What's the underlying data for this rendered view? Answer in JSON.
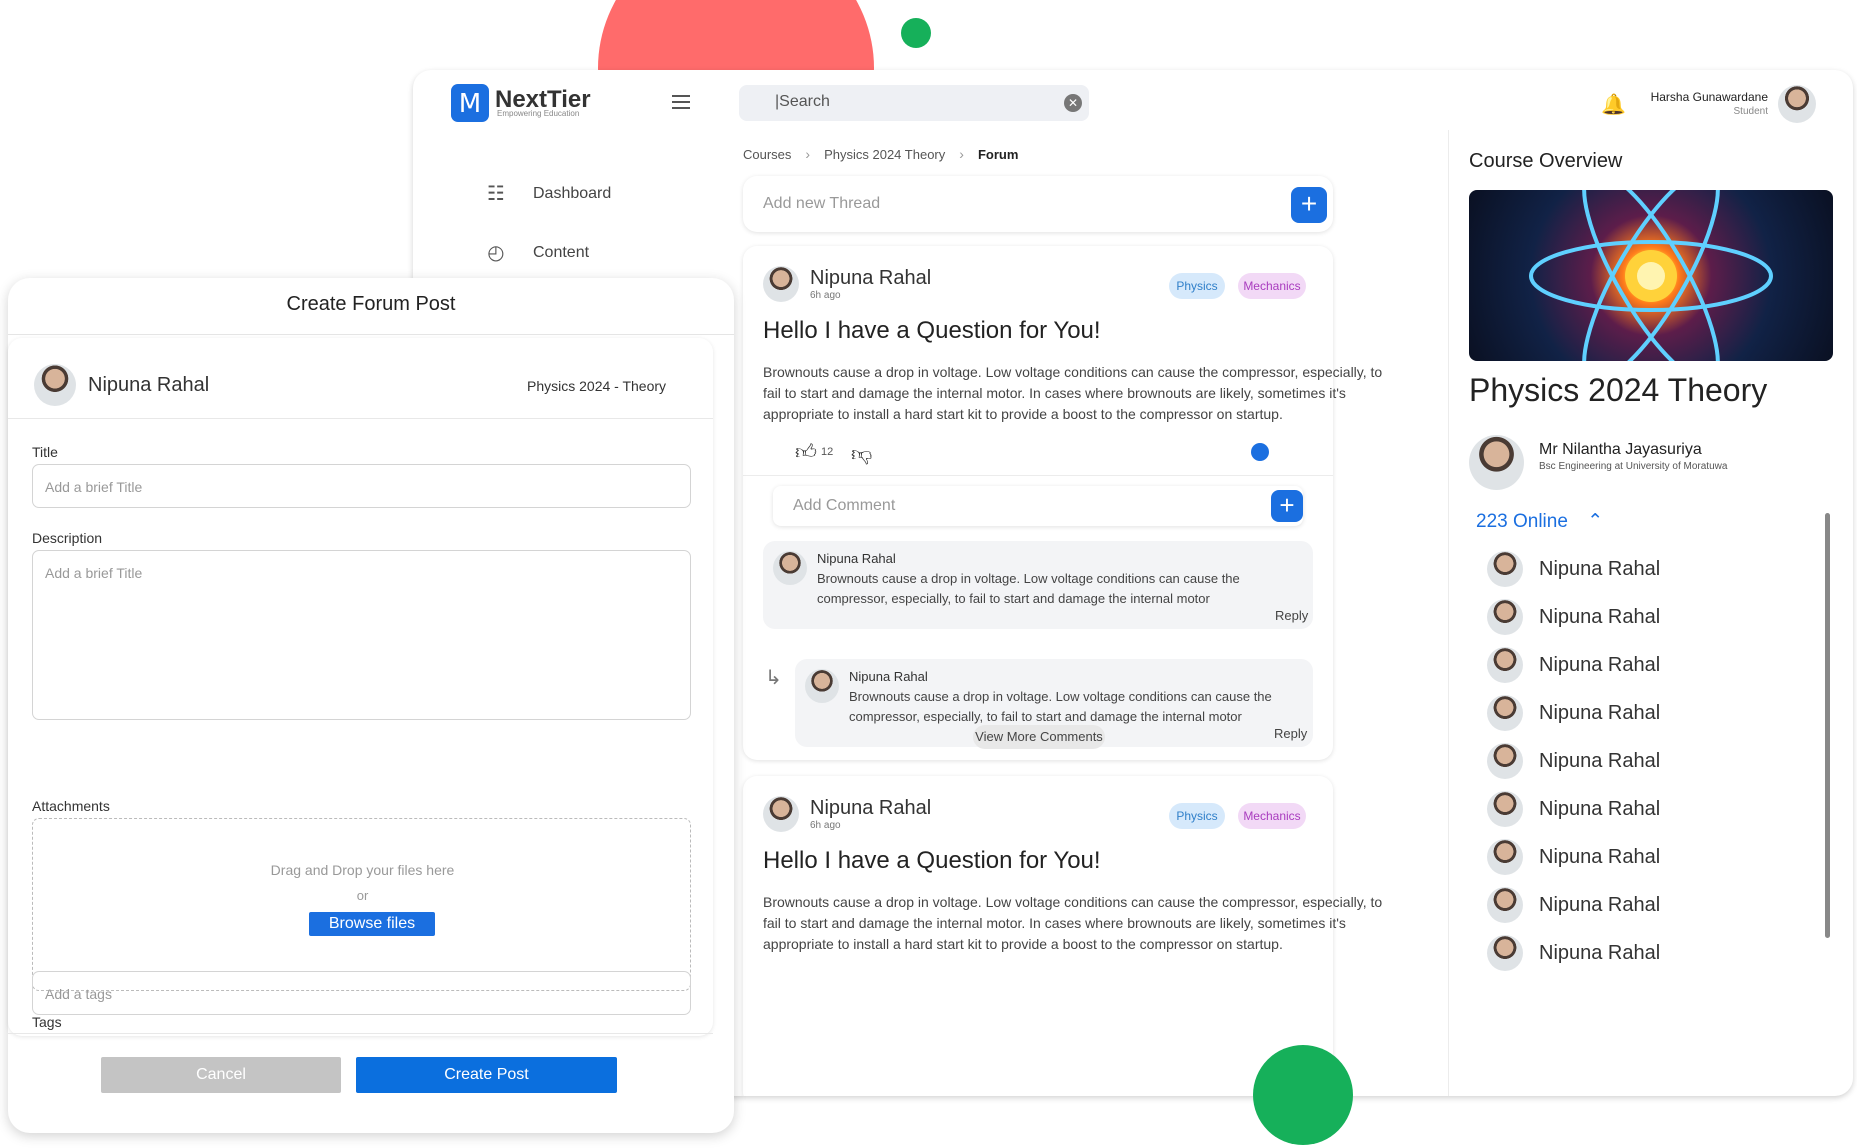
{
  "brand": {
    "name": "NextTier",
    "tagline": "Empowering Education"
  },
  "sidebar": {
    "items": [
      {
        "label": "Dashboard",
        "icon": "dashboard-icon"
      },
      {
        "label": "Content",
        "icon": "content-icon"
      }
    ]
  },
  "search": {
    "value": "|Search"
  },
  "user": {
    "name": "Harsha Gunawardane",
    "role": "Student"
  },
  "breadcrumb": [
    "Courses",
    "Physics 2024 Theory",
    "Forum"
  ],
  "thread_input": {
    "placeholder": "Add new Thread"
  },
  "posts": [
    {
      "author": "Nipuna Rahal",
      "time": "6h ago",
      "tags": [
        "Physics",
        "Mechanics"
      ],
      "title": "Hello I have a Question for You!",
      "body": "Brownouts cause a drop in voltage. Low voltage conditions can cause the compressor, especially, to fail to start and damage the internal motor. In cases where brownouts are likely, sometimes it's appropriate to install a hard start kit to provide a boost to the compressor on startup.",
      "likes": "12",
      "comment_placeholder": "Add Comment",
      "comments": [
        {
          "author": "Nipuna Rahal",
          "text": "Brownouts cause a drop in voltage. Low voltage conditions can cause the compressor, especially, to fail to start and damage the internal motor",
          "reply": "Reply"
        },
        {
          "author": "Nipuna Rahal",
          "text": "Brownouts cause a drop in voltage. Low voltage conditions can cause the compressor, especially, to fail to start and damage the internal motor",
          "reply": "Reply"
        }
      ],
      "view_more": "View More Comments"
    },
    {
      "author": "Nipuna Rahal",
      "time": "6h ago",
      "tags": [
        "Physics",
        "Mechanics"
      ],
      "title": "Hello I have a Question for You!",
      "body": "Brownouts cause a drop in voltage. Low voltage conditions can cause the compressor, especially, to fail to start and damage the internal motor. In cases where brownouts are likely, sometimes it's appropriate to install a hard start kit to provide a boost to the compressor on startup."
    }
  ],
  "course": {
    "heading": "Course Overview",
    "title": "Physics 2024 Theory",
    "lecturer": "Mr Nilantha Jayasuriya",
    "lecturer_detail": "Bsc Engineering at University of Moratuwa",
    "online_label": "223 Online",
    "online_users": [
      "Nipuna Rahal",
      "Nipuna Rahal",
      "Nipuna Rahal",
      "Nipuna Rahal",
      "Nipuna Rahal",
      "Nipuna Rahal",
      "Nipuna Rahal",
      "Nipuna Rahal",
      "Nipuna Rahal"
    ]
  },
  "modal": {
    "title": "Create Forum Post",
    "author": "Nipuna Rahal",
    "course": "Physics 2024 - Theory",
    "title_label": "Title",
    "title_placeholder": "Add a brief Title",
    "description_label": "Description",
    "description_placeholder": "Add a brief Title",
    "attachments_label": "Attachments",
    "drop_text": "Drag and Drop your files here",
    "or_text": "or",
    "browse_label": "Browse files",
    "tags_label": "Tags",
    "tags_placeholder": "Add a tags",
    "cancel_label": "Cancel",
    "create_label": "Create Post"
  },
  "colors": {
    "accent": "#1b6fe0",
    "deco_red": "#ff6b6b",
    "deco_green": "#16b05a"
  }
}
